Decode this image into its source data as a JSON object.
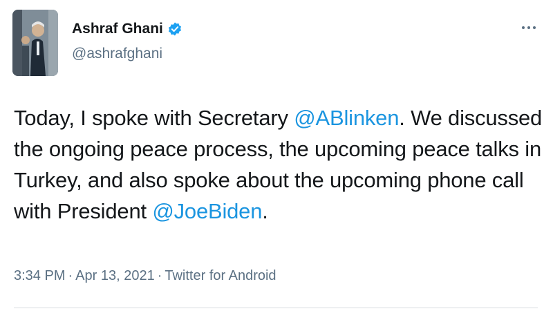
{
  "author": {
    "display_name": "Ashraf Ghani",
    "handle": "@ashrafghani",
    "verified_icon": "verified-badge-icon",
    "avatar_icon": "profile-photo"
  },
  "tweet": {
    "segments": [
      {
        "type": "text",
        "value": "Today, I spoke with Secretary "
      },
      {
        "type": "mention",
        "value": "@ABlinken"
      },
      {
        "type": "text",
        "value": ". We discussed the ongoing peace process, the upcoming peace talks in Turkey, and also spoke about the upcoming phone call with President "
      },
      {
        "type": "mention",
        "value": "@JoeBiden"
      },
      {
        "type": "text",
        "value": "."
      }
    ]
  },
  "meta": {
    "time": "3:34 PM",
    "separator": "·",
    "date": "Apr 13, 2021",
    "source": "Twitter for Android"
  },
  "colors": {
    "link": "#1b95e0",
    "text": "#14171a",
    "secondary": "#5b7083",
    "verified": "#1da1f2"
  },
  "more_icon": "more-options-icon"
}
